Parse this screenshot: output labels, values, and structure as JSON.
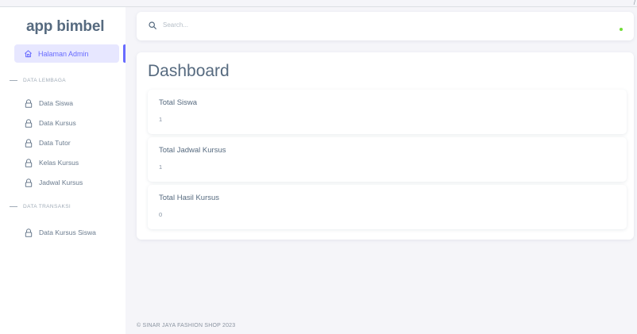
{
  "app": {
    "brand": "app bimbel"
  },
  "sidebar": {
    "active_item": {
      "label": "Halaman Admin",
      "icon": "home-icon"
    },
    "sections": [
      {
        "header": "DATA LEMBAGA",
        "items": [
          {
            "label": "Data Siswa",
            "icon": "lock-icon"
          },
          {
            "label": "Data Kursus",
            "icon": "lock-icon"
          },
          {
            "label": "Data Tutor",
            "icon": "lock-icon"
          },
          {
            "label": "Kelas Kursus",
            "icon": "lock-icon"
          },
          {
            "label": "Jadwal Kursus",
            "icon": "lock-icon"
          }
        ]
      },
      {
        "header": "DATA TRANSAKSI",
        "items": [
          {
            "label": "Data Kursus Siswa",
            "icon": "lock-icon"
          }
        ]
      }
    ]
  },
  "search": {
    "placeholder": "Search...",
    "icon": "search-icon"
  },
  "status": {
    "color": "#71dd37"
  },
  "main": {
    "title": "Dashboard",
    "stats": [
      {
        "label": "Total Siswa",
        "value": "1"
      },
      {
        "label": "Total Jadwal Kursus",
        "value": "1"
      },
      {
        "label": "Total Hasil Kursus",
        "value": "0"
      }
    ]
  },
  "footer": {
    "text": "© SINAR JAYA FASHION SHOP 2023"
  },
  "colors": {
    "accent": "#696cff",
    "accent_bg": "#e7e7ff",
    "text": "#566a7f",
    "background": "#f5f5f9"
  }
}
